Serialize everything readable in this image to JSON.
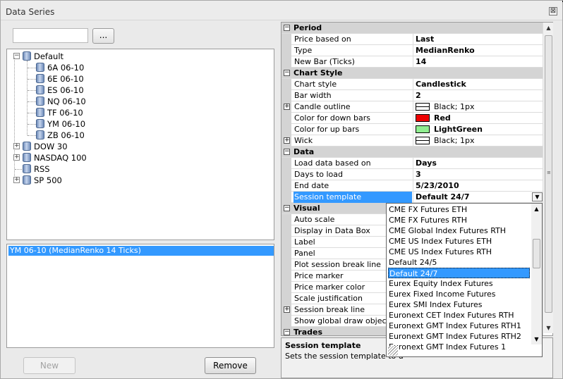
{
  "window": {
    "title": "Data Series",
    "close_glyph": "⊠"
  },
  "search": {
    "value": "",
    "browse_label": "..."
  },
  "tree": {
    "root": {
      "label": "Default",
      "expanded": true,
      "children": [
        "6A 06-10",
        "6E 06-10",
        "ES 06-10",
        "NQ 06-10",
        "TF 06-10",
        "YM 06-10",
        "ZB 06-10"
      ]
    },
    "others": [
      {
        "label": "DOW 30",
        "expandable": true
      },
      {
        "label": "NASDAQ 100",
        "expandable": true
      },
      {
        "label": "RSS",
        "expandable": false
      },
      {
        "label": "SP 500",
        "expandable": true
      }
    ]
  },
  "selected_series": [
    "YM 06-10 (MedianRenko 14 Ticks)"
  ],
  "buttons": {
    "new": "New",
    "remove": "Remove"
  },
  "properties": {
    "period": {
      "title": "Period",
      "rows": [
        {
          "name": "Price based on",
          "value": "Last"
        },
        {
          "name": "Type",
          "value": "MedianRenko"
        },
        {
          "name": "New Bar (Ticks)",
          "value": "14"
        }
      ]
    },
    "chart_style": {
      "title": "Chart Style",
      "rows": [
        {
          "name": "Chart style",
          "value": "Candlestick"
        },
        {
          "name": "Bar width",
          "value": "2"
        },
        {
          "name": "Candle outline",
          "value": "Black; 1px"
        },
        {
          "name": "Color for down bars",
          "value": "Red",
          "color": "#ee0000"
        },
        {
          "name": "Color for up bars",
          "value": "LightGreen",
          "color": "#90ee90"
        },
        {
          "name": "Wick",
          "value": "Black; 1px"
        }
      ]
    },
    "data": {
      "title": "Data",
      "rows": [
        {
          "name": "Load data based on",
          "value": "Days"
        },
        {
          "name": "Days to load",
          "value": "3"
        },
        {
          "name": "End date",
          "value": "5/23/2010"
        },
        {
          "name": "Session template",
          "value": "Default 24/7"
        }
      ]
    },
    "visual": {
      "title": "Visual",
      "rows": [
        "Auto scale",
        "Display in Data Box",
        "Label",
        "Panel",
        "Plot session break line",
        "Price marker",
        "Price marker color",
        "Scale justification",
        "Session break line",
        "Show global draw objects"
      ]
    },
    "trades": {
      "title": "Trades"
    }
  },
  "session_dropdown": {
    "options": [
      "CME FX Futures ETH",
      "CME FX Futures RTH",
      "CME Global Index Futures RTH",
      "CME US Index Futures ETH",
      "CME US Index Futures RTH",
      "Default 24/5",
      "Default 24/7",
      "Eurex Equity Index Futures",
      "Eurex Fixed Income Futures",
      "Eurex SMI Index Futures",
      "Euronext CET Index Futures RTH",
      "Euronext GMT Index Futures RTH1",
      "Euronext GMT Index Futures RTH2",
      "Euronext GMT Index Futures 1"
    ],
    "selected": "Default 24/7"
  },
  "description": {
    "title": "Session template",
    "text": "Sets the session template to u"
  },
  "glyphs": {
    "minus": "−",
    "plus": "+",
    "up": "▲",
    "down": "▼",
    "grip": "≡"
  },
  "colors": {
    "selection": "#3399ff",
    "category": "#d4d4d4"
  }
}
